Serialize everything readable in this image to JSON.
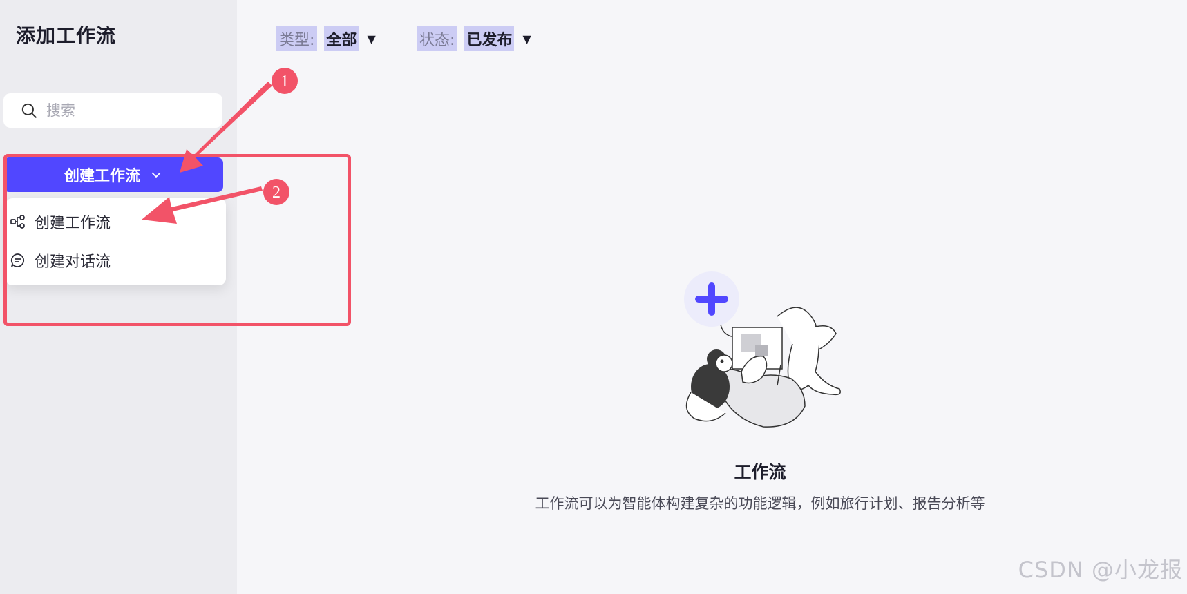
{
  "sidebar": {
    "title": "添加工作流",
    "search": {
      "placeholder": "搜索",
      "value": ""
    },
    "create_button": {
      "label": "创建工作流"
    },
    "dropdown": {
      "items": [
        {
          "label": "创建工作流",
          "icon": "workflow-icon"
        },
        {
          "label": "创建对话流",
          "icon": "chat-icon"
        }
      ]
    }
  },
  "filters": {
    "type": {
      "label": "类型:",
      "value": "全部"
    },
    "status": {
      "label": "状态:",
      "value": "已发布"
    }
  },
  "empty_state": {
    "title": "工作流",
    "description": "工作流可以为智能体构建复杂的功能逻辑，例如旅行计划、报告分析等"
  },
  "annotations": {
    "marker_1": "1",
    "marker_2": "2",
    "color": "#f25368"
  },
  "accent_color": "#5147ff",
  "watermark": "CSDN @小龙报"
}
